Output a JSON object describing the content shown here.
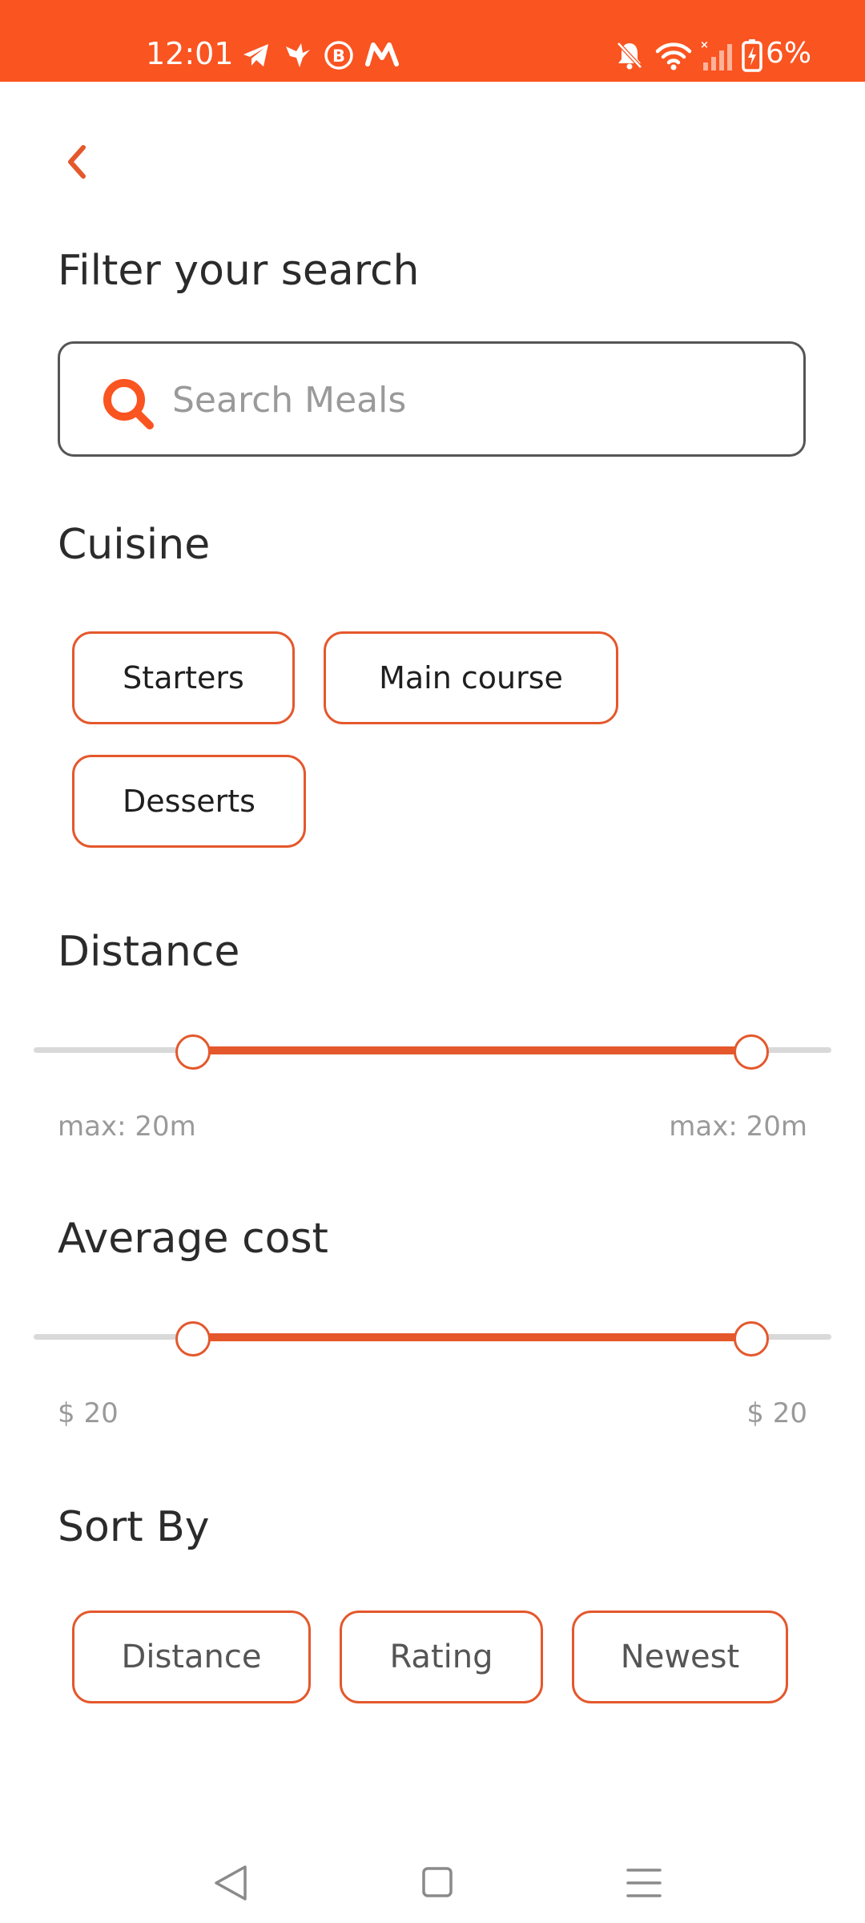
{
  "status_bar": {
    "time": "12:01",
    "battery": "6%",
    "icons": [
      "telegram-icon",
      "bird-icon",
      "b-circle-icon",
      "m-logo-icon",
      "bell-off-icon",
      "wifi-icon",
      "signal-icon",
      "battery-charging-icon"
    ],
    "background_color": "#fa5421"
  },
  "header": {
    "back_icon": "chevron-left-icon",
    "title": "Filter your search"
  },
  "search": {
    "placeholder": "Search Meals",
    "value": "",
    "icon": "search-icon"
  },
  "cuisine": {
    "title": "Cuisine",
    "options": [
      "Starters",
      "Main course",
      "Desserts"
    ]
  },
  "distance": {
    "title": "Distance",
    "min_label": "max: 20m",
    "max_label": "max: 20m",
    "range_low": 0.2,
    "range_high": 0.9
  },
  "average_cost": {
    "title": "Average cost",
    "min_label": "$ 20",
    "max_label": "$ 20",
    "range_low": 0.2,
    "range_high": 0.9
  },
  "sort_by": {
    "title": "Sort By",
    "options": [
      "Distance",
      "Rating",
      "Newest"
    ]
  },
  "nav_bar": {
    "icons": [
      "back-triangle-icon",
      "home-square-icon",
      "recents-menu-icon"
    ]
  },
  "colors": {
    "accent": "#e4582c",
    "status_bar": "#fa5421",
    "text_primary": "#2b2b2b",
    "text_muted": "#9a9a9a",
    "track": "#d9d9d9"
  }
}
